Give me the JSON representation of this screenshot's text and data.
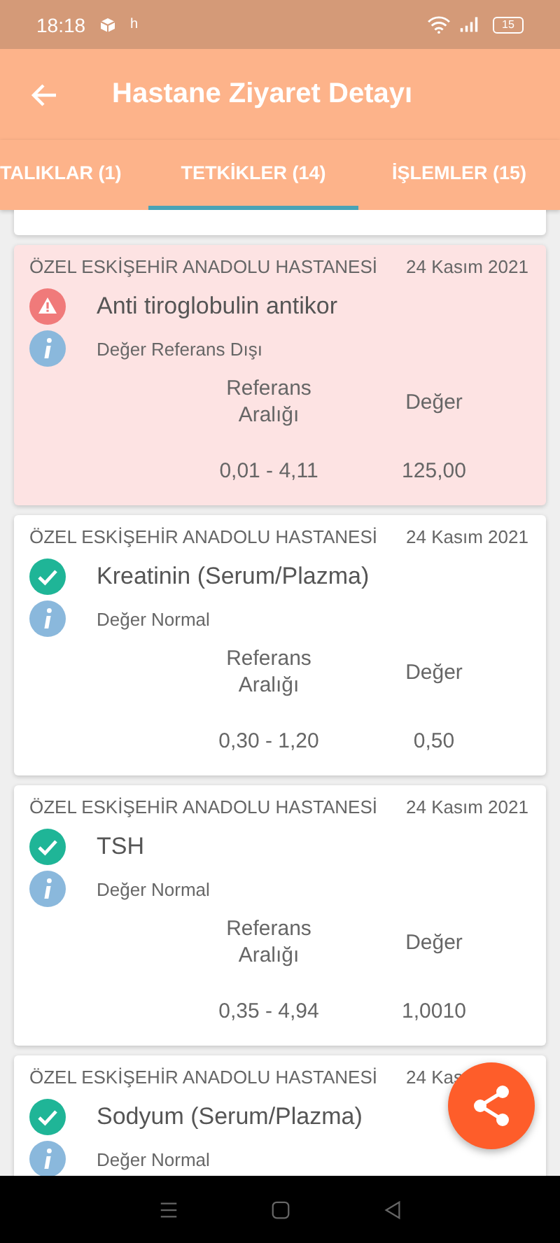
{
  "status_bar": {
    "time": "18:18",
    "notification_text": "h",
    "battery": "15"
  },
  "app_bar": {
    "title": "Hastane Ziyaret Detayı"
  },
  "tabs": [
    {
      "label": "TALIKLAR (1)",
      "selected": false
    },
    {
      "label": "TETKİKLER (14)",
      "selected": true
    },
    {
      "label": "İŞLEMLER (15)",
      "selected": false
    }
  ],
  "results": [
    {
      "hospital": "ÖZEL ESKİŞEHİR ANADOLU HASTANESİ",
      "date": "24 Kasım 2021",
      "kind": "abnormal",
      "test": "Anti tiroglobulin antikor",
      "status": "Değer Referans Dışı",
      "range_header": "Referans Aralığı",
      "value_header": "Değer",
      "range": "0,01 - 4,11",
      "value": "125,00"
    },
    {
      "hospital": "ÖZEL ESKİŞEHİR ANADOLU HASTANESİ",
      "date": "24 Kasım 2021",
      "kind": "normal",
      "test": "Kreatinin (Serum/Plazma)",
      "status": "Değer Normal",
      "range_header": "Referans Aralığı",
      "value_header": "Değer",
      "range": "0,30 - 1,20",
      "value": "0,50"
    },
    {
      "hospital": "ÖZEL ESKİŞEHİR ANADOLU HASTANESİ",
      "date": "24 Kasım 2021",
      "kind": "normal",
      "test": "TSH",
      "status": "Değer Normal",
      "range_header": "Referans Aralığı",
      "value_header": "Değer",
      "range": "0,35 - 4,94",
      "value": "1,0010"
    },
    {
      "hospital": "ÖZEL ESKİŞEHİR ANADOLU HASTANESİ",
      "date": "24 Kas",
      "kind": "normal",
      "test": "Sodyum (Serum/Plazma)",
      "status": "Değer Normal"
    }
  ]
}
